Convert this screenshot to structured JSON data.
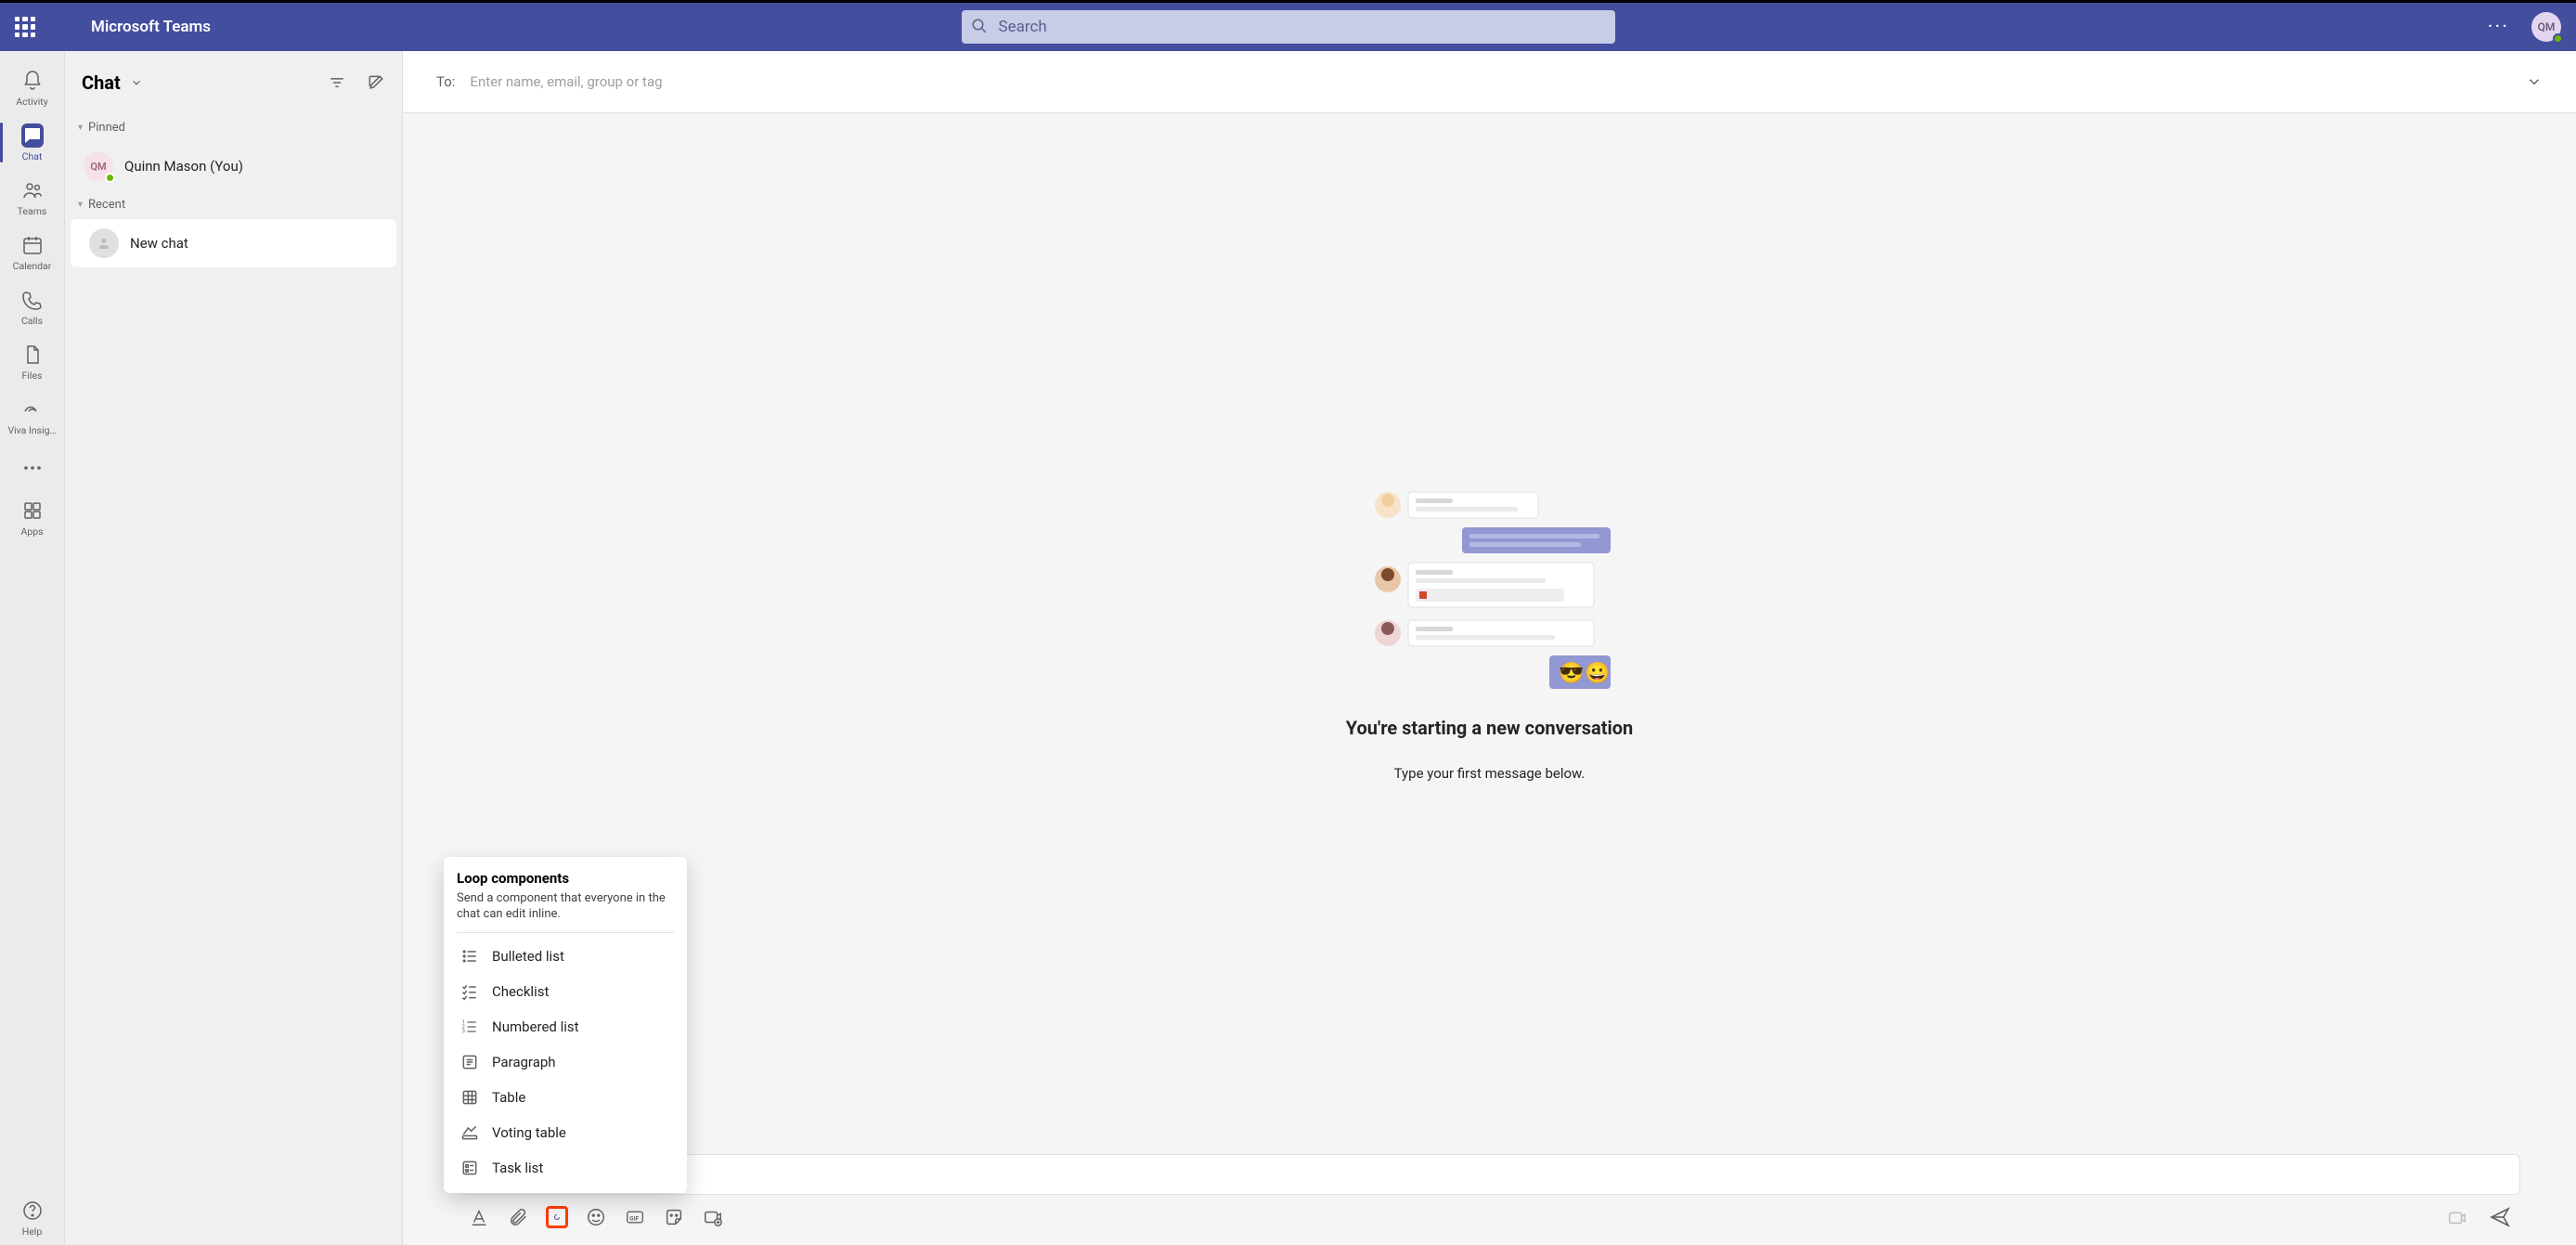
{
  "app": {
    "title": "Microsoft Teams",
    "search_placeholder": "Search"
  },
  "user": {
    "initials": "QM"
  },
  "rail": {
    "activity": "Activity",
    "chat": "Chat",
    "teams": "Teams",
    "calendar": "Calendar",
    "calls": "Calls",
    "files": "Files",
    "viva": "Viva Insig…",
    "apps": "Apps",
    "help": "Help"
  },
  "chatlist": {
    "title": "Chat",
    "pinned_label": "Pinned",
    "pinned_items": [
      {
        "initials": "QM",
        "label": "Quinn Mason (You)"
      }
    ],
    "recent_label": "Recent",
    "recent_items": [
      {
        "label": "New chat"
      }
    ]
  },
  "to": {
    "label": "To:",
    "placeholder": "Enter name, email, group or tag"
  },
  "convo": {
    "title": "You're starting a new conversation",
    "subtitle": "Type your first message below."
  },
  "loop": {
    "title": "Loop components",
    "desc": "Send a component that everyone in the chat can edit inline.",
    "items": [
      "Bulleted list",
      "Checklist",
      "Numbered list",
      "Paragraph",
      "Table",
      "Voting table",
      "Task list"
    ]
  }
}
